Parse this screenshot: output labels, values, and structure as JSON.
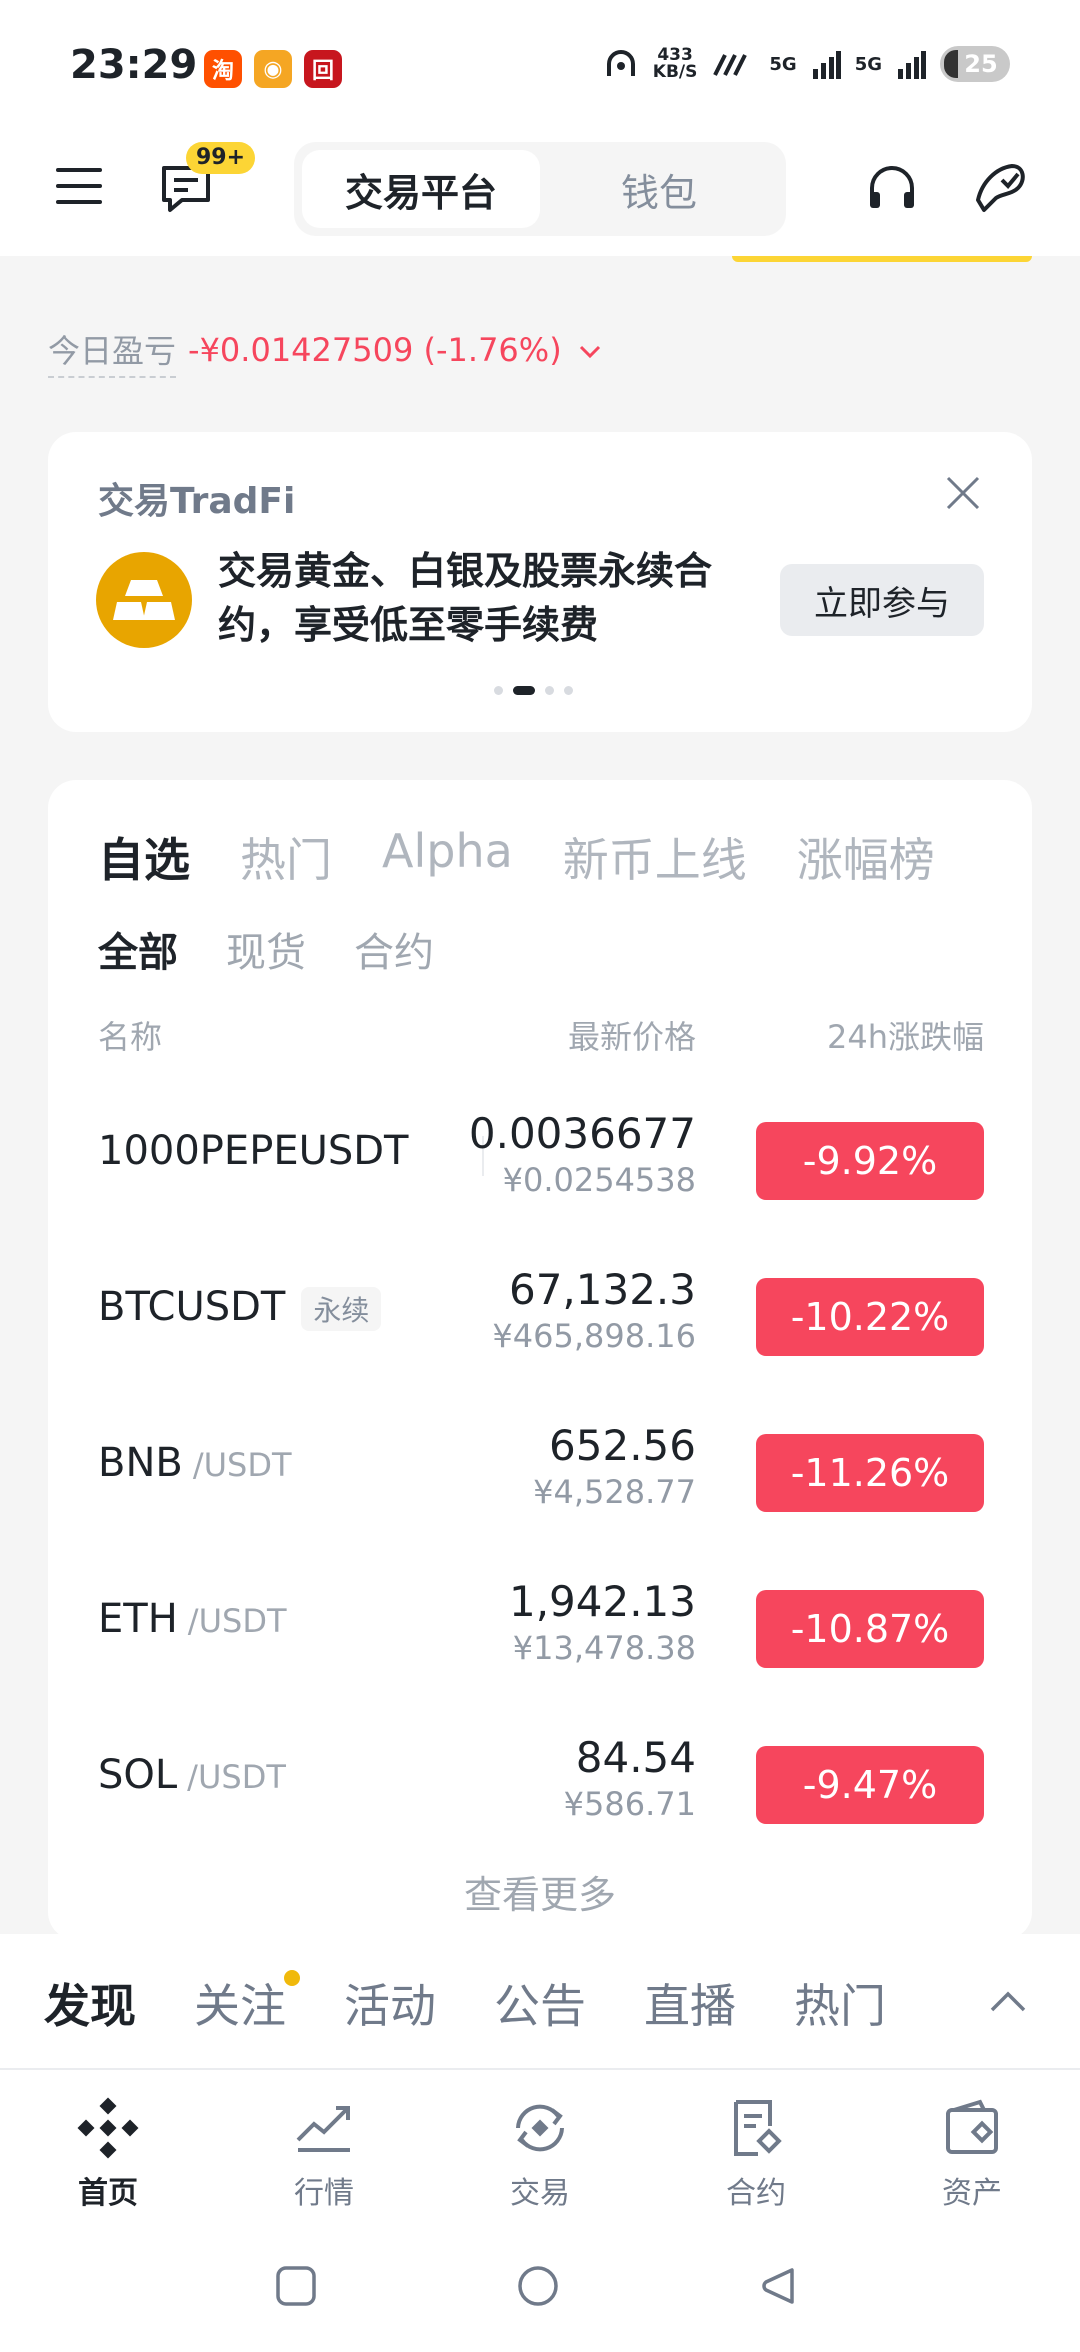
{
  "status_bar": {
    "time": "23:29",
    "apps": [
      {
        "icon": "taobao-icon",
        "glyph": "淘",
        "color": "#ff5000"
      },
      {
        "icon": "weibo-icon",
        "glyph": "◉",
        "color": "#f5a623"
      },
      {
        "icon": "bank-icon",
        "glyph": "回",
        "color": "#c7161e"
      }
    ],
    "speed_top": "433",
    "speed_bottom": "KB/S",
    "sig1": "5G",
    "sig2": "5G",
    "battery": "25"
  },
  "header": {
    "badge": "99+",
    "segments": [
      {
        "label": "交易平台",
        "active": true
      },
      {
        "label": "钱包",
        "active": false
      }
    ]
  },
  "pnl": {
    "label": "今日盈亏",
    "value": "-¥0.01427509 (-1.76%)"
  },
  "banner": {
    "title": "交易TradFi",
    "text": "交易黄金、白银及股票永续合约，享受低至零手续费",
    "button": "立即参与",
    "pages": 4,
    "active_page": 2
  },
  "market": {
    "tabs": [
      "自选",
      "热门",
      "Alpha",
      "新币上线",
      "涨幅榜"
    ],
    "subtabs": [
      "全部",
      "现货",
      "合约"
    ],
    "columns": {
      "name": "名称",
      "price": "最新价格",
      "change": "24h涨跌幅"
    },
    "rows": [
      {
        "symbol": "1000PEPEUSDT",
        "quote": "",
        "tag": "",
        "price": "0.0036677",
        "cny": "¥0.0254538",
        "change": "-9.92%"
      },
      {
        "symbol": "BTCUSDT",
        "quote": "",
        "tag": "永续",
        "price": "67,132.3",
        "cny": "¥465,898.16",
        "change": "-10.22%"
      },
      {
        "symbol": "BNB",
        "quote": "/USDT",
        "tag": "",
        "price": "652.56",
        "cny": "¥4,528.77",
        "change": "-11.26%"
      },
      {
        "symbol": "ETH",
        "quote": "/USDT",
        "tag": "",
        "price": "1,942.13",
        "cny": "¥13,478.38",
        "change": "-10.87%"
      },
      {
        "symbol": "SOL",
        "quote": "/USDT",
        "tag": "",
        "price": "84.54",
        "cny": "¥586.71",
        "change": "-9.47%"
      }
    ],
    "more": "查看更多"
  },
  "feed": {
    "tabs": [
      "发现",
      "关注",
      "活动",
      "公告",
      "直播",
      "热门"
    ]
  },
  "bottom_nav": [
    {
      "label": "首页",
      "icon": "home-icon",
      "active": true
    },
    {
      "label": "行情",
      "icon": "markets-icon",
      "active": false
    },
    {
      "label": "交易",
      "icon": "trade-icon",
      "active": false
    },
    {
      "label": "合约",
      "icon": "futures-icon",
      "active": false
    },
    {
      "label": "资产",
      "icon": "assets-icon",
      "active": false
    }
  ],
  "colors": {
    "accent": "#fcd535",
    "down": "#f6465d",
    "text": "#1e2329",
    "muted": "#a0a7b0"
  }
}
